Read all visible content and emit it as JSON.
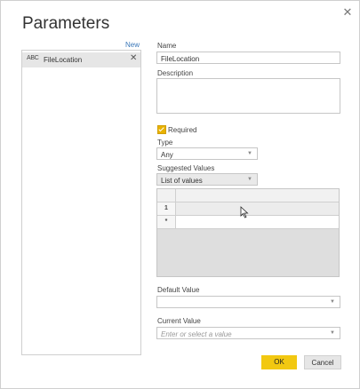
{
  "dialog": {
    "title": "Parameters",
    "close_glyph": "✕",
    "new_link": "New",
    "parameters": [
      {
        "icon": "ABC",
        "label": "FileLocation",
        "delete_glyph": "✕"
      }
    ]
  },
  "form": {
    "name_label": "Name",
    "name_value": "FileLocation",
    "description_label": "Description",
    "description_value": "",
    "required_label": "Required",
    "required_checked": true,
    "type_label": "Type",
    "type_value": "Any",
    "suggested_label": "Suggested Values",
    "suggested_value": "List of values",
    "grid_rows": [
      {
        "num": "1",
        "value": ""
      },
      {
        "num": "*",
        "value": ""
      }
    ],
    "default_label": "Default Value",
    "default_value": "",
    "current_label": "Current Value",
    "current_placeholder": "Enter or select a value"
  },
  "buttons": {
    "ok": "OK",
    "cancel": "Cancel"
  },
  "colors": {
    "accent": "#f2c811",
    "checkbox": "#e9b200",
    "link": "#3a77b8"
  }
}
